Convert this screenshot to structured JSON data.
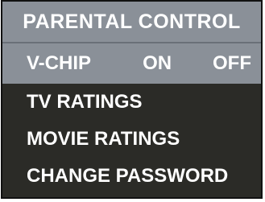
{
  "header": {
    "title": "PARENTAL CONTROL"
  },
  "vchip": {
    "label": "V-CHIP",
    "options": [
      "ON",
      "OFF"
    ]
  },
  "menu": {
    "items": [
      {
        "label": "TV RATINGS"
      },
      {
        "label": "MOVIE RATINGS"
      },
      {
        "label": "CHANGE PASSWORD"
      }
    ]
  },
  "colors": {
    "header_bg": "#8a9098",
    "body_bg": "#2b2b27",
    "text": "#ffffff"
  }
}
